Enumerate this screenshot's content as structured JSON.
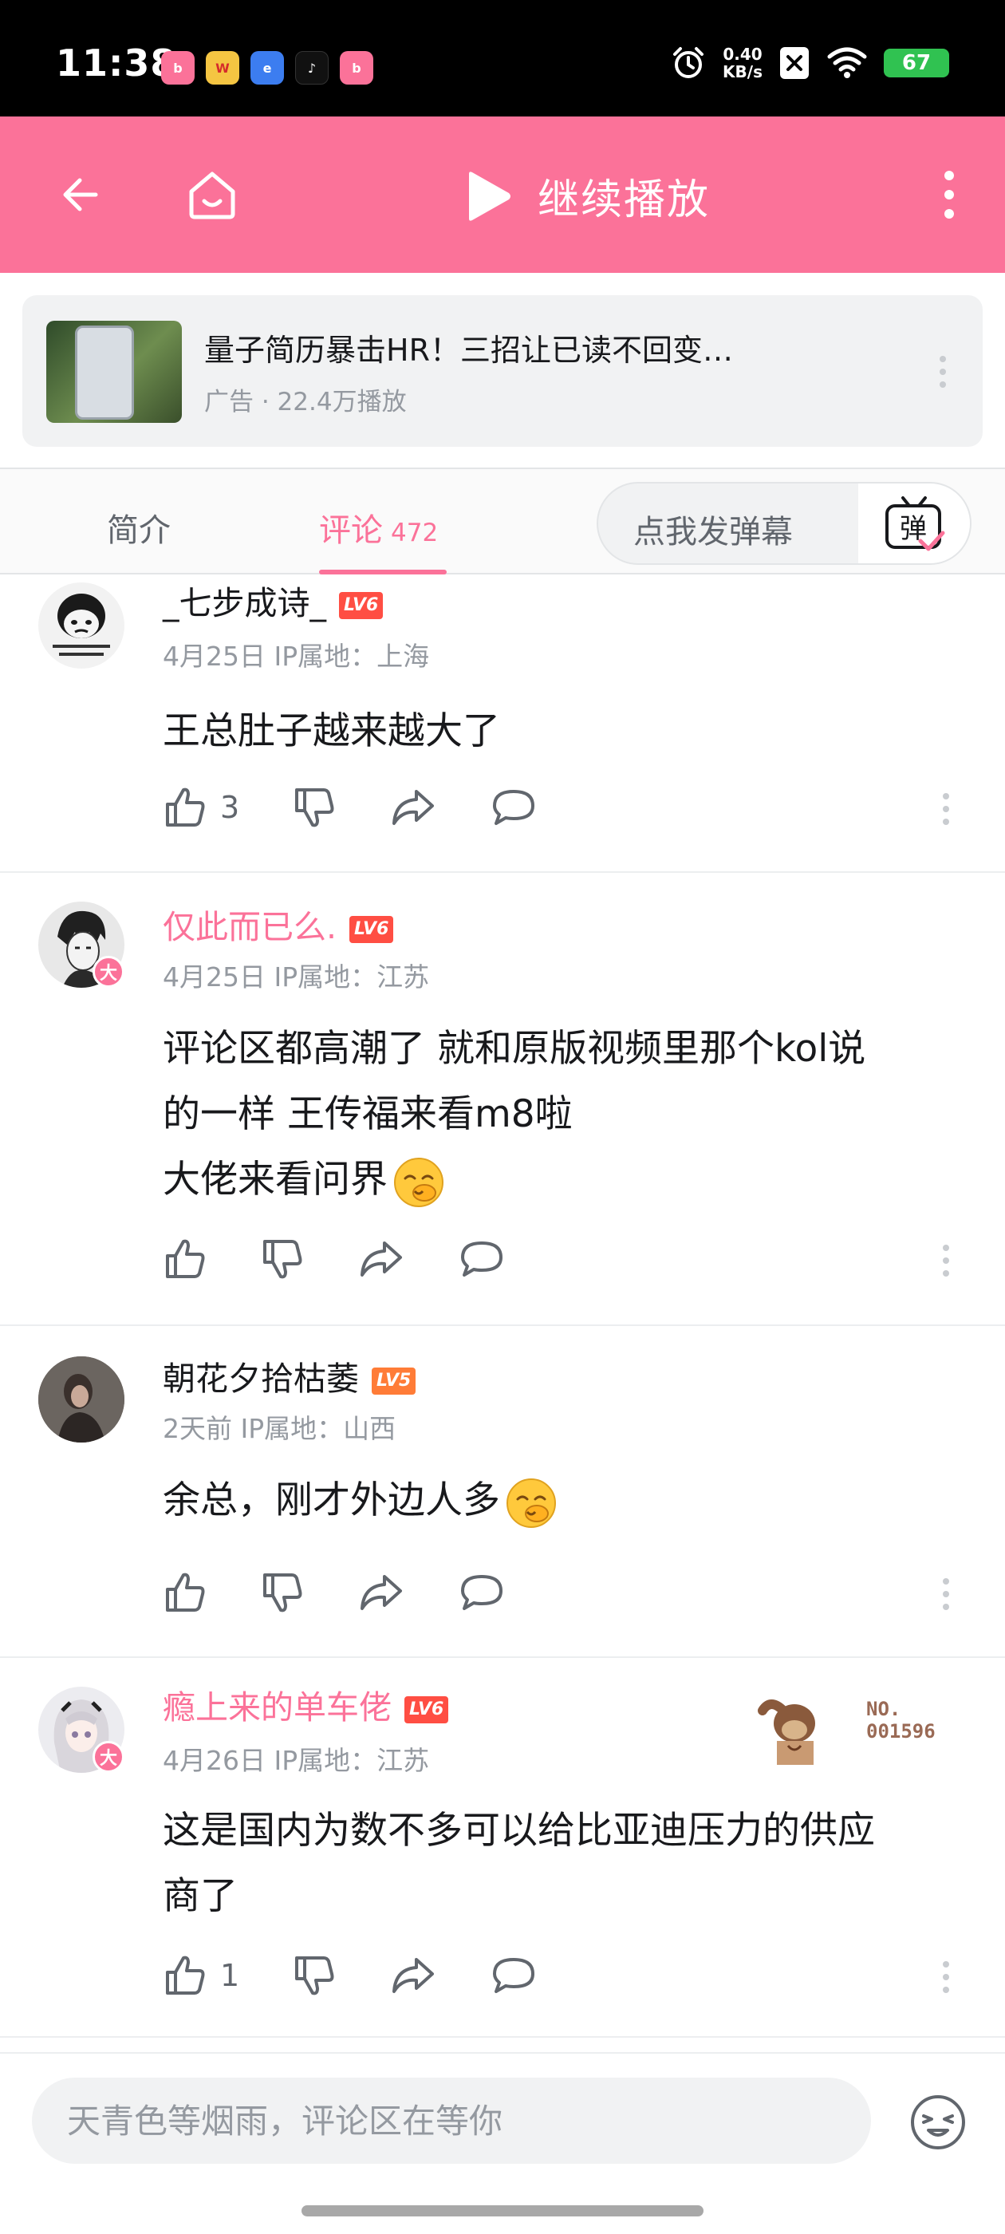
{
  "status_bar": {
    "time": "11:38",
    "notifications": [
      "bilibili-app-icon",
      "weibo-app-icon",
      "browser-app-icon",
      "tiktok-app-icon",
      "bilibili-app-icon"
    ],
    "net_speed_value": "0.40",
    "net_speed_unit": "KB/s",
    "battery": "67"
  },
  "header": {
    "play_label": "继续播放",
    "accent_color": "#fb7299"
  },
  "ad": {
    "title": "量子简历暴击HR！三招让已读不回变…",
    "meta": "广告 · 22.4万播放"
  },
  "tabs": {
    "intro": "简介",
    "comments": "评论",
    "comments_count": "472",
    "danmaku_placeholder": "点我发弹幕",
    "danmaku_button": "弹"
  },
  "comments": [
    {
      "username": "_七步成诗_",
      "level": "LV6",
      "meta": "4月25日 IP属地：上海",
      "text": "王总肚子越来越大了",
      "likes": "3"
    },
    {
      "username": "仅此而已么.",
      "level": "LV6",
      "meta": "4月25日 IP属地：江苏",
      "badge": "大",
      "text_line1": "评论区都高潮了 就和原版视频里那个kol说",
      "text_line2": "的一样 王传福来看m8啦",
      "text_line3": "大佬来看问界",
      "emoji": "snicker-emoji"
    },
    {
      "username": "朝花夕拾枯萎",
      "level": "LV5",
      "meta": "2天前 IP属地：山西",
      "text": "余总，刚才外边人多",
      "emoji": "snicker-emoji"
    },
    {
      "username": "瘾上来的单车佬",
      "level": "LV6",
      "meta": "4月26日 IP属地：江苏",
      "badge": "大",
      "fan_label": "NO.",
      "fan_number": "001596",
      "text_line1": "这是国内为数不多可以给比亚迪压力的供应",
      "text_line2": "商了",
      "likes": "1"
    }
  ],
  "bottom": {
    "input_placeholder": "天青色等烟雨，评论区在等你"
  }
}
